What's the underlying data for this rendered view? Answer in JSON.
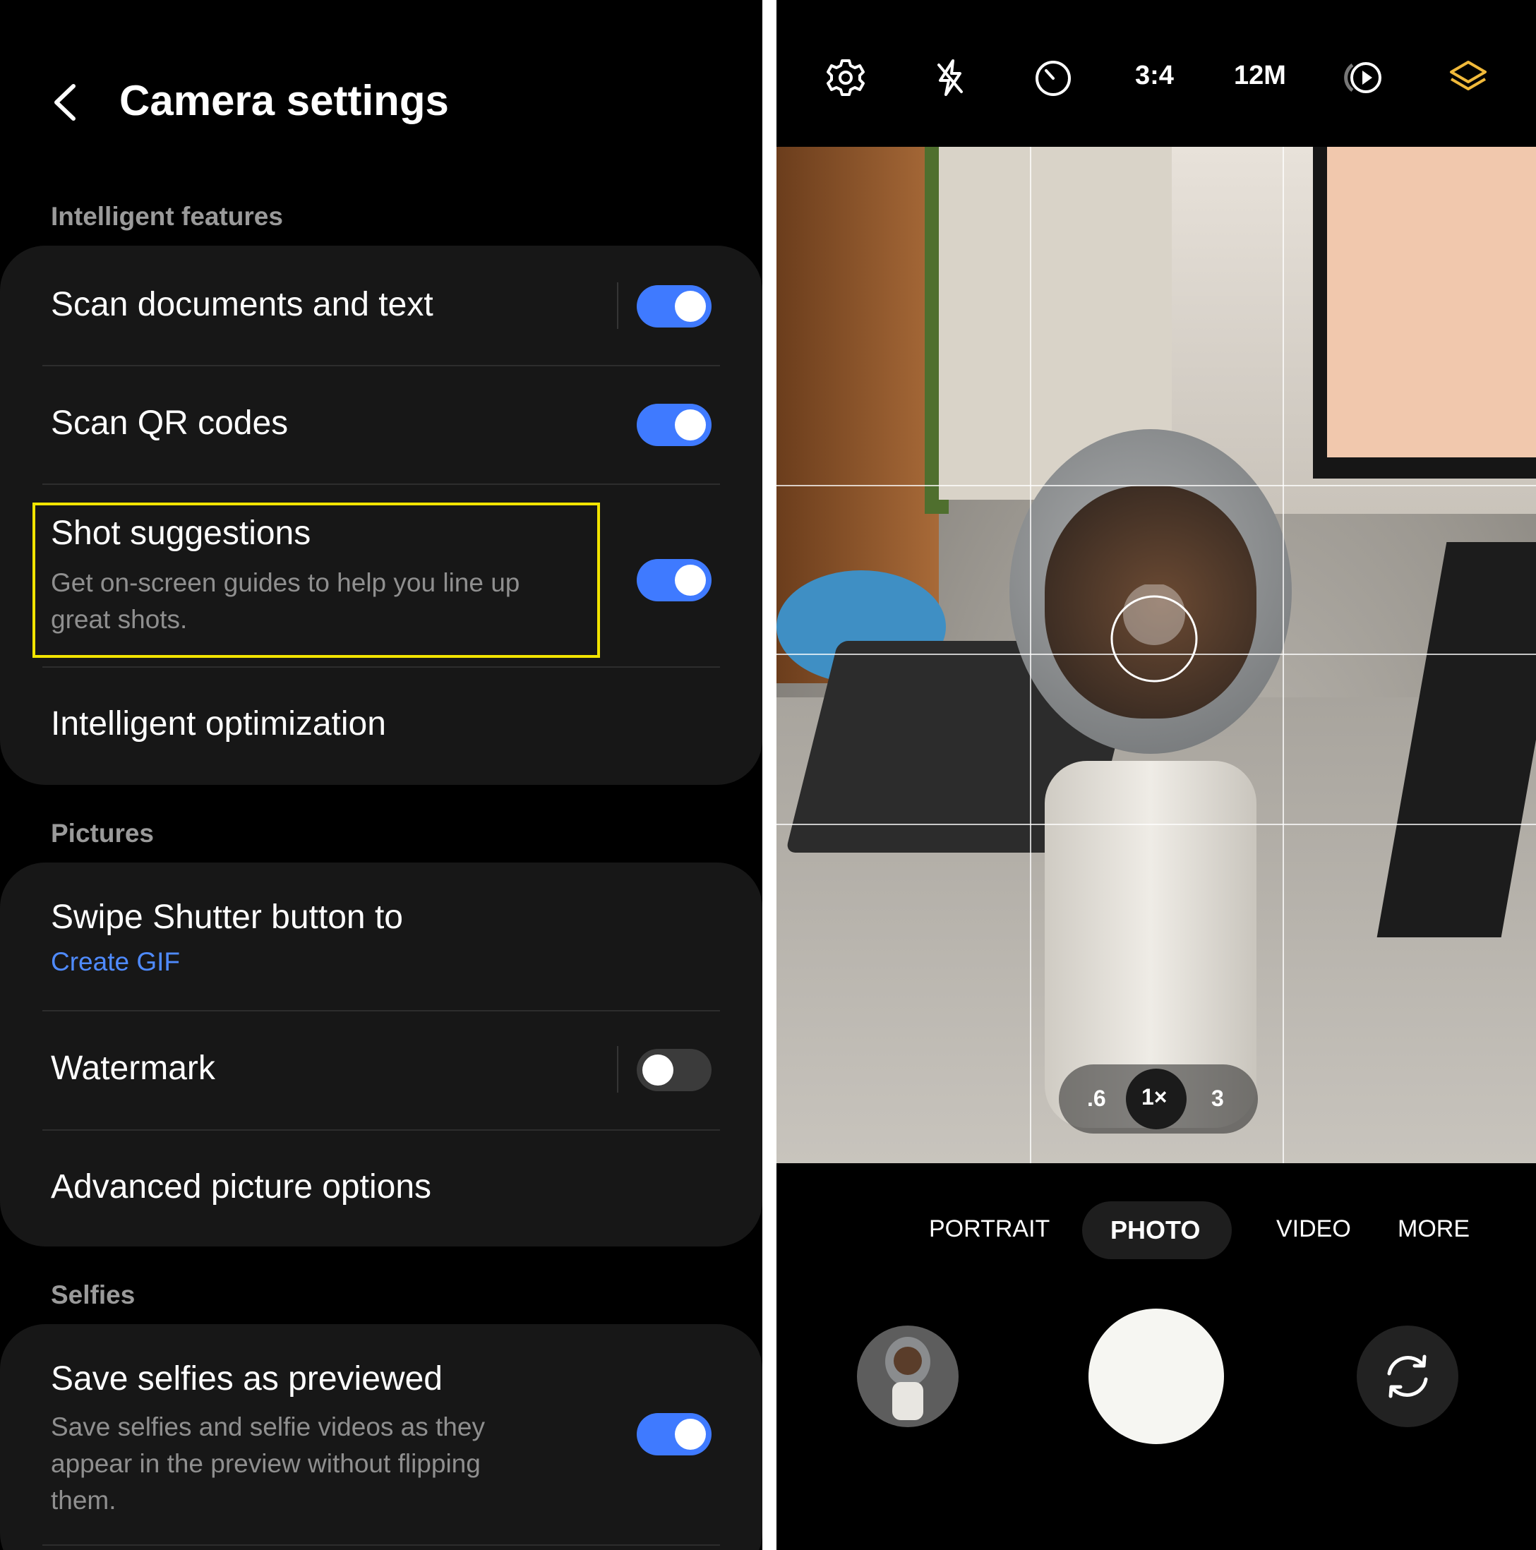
{
  "settings": {
    "title": "Camera settings",
    "sections": {
      "intelligent": {
        "header": "Intelligent features",
        "scan_docs": "Scan documents and text",
        "scan_qr": "Scan QR codes",
        "shot_suggestions": "Shot suggestions",
        "shot_suggestions_desc_1": "Get on-screen guides to help you line up",
        "shot_suggestions_desc_2": "great shots.",
        "intelligent_optimization": "Intelligent optimization"
      },
      "pictures": {
        "header": "Pictures",
        "swipe_shutter": "Swipe Shutter button to",
        "swipe_shutter_value": "Create GIF",
        "watermark": "Watermark",
        "advanced": "Advanced picture options"
      },
      "selfies": {
        "header": "Selfies",
        "save_selfies": "Save selfies as previewed",
        "save_selfies_desc_1": "Save selfies and selfie videos as they",
        "save_selfies_desc_2": "appear in the preview without flipping",
        "save_selfies_desc_3": "them."
      }
    },
    "toggles": {
      "scan_docs": true,
      "scan_qr": true,
      "shot_suggestions": true,
      "watermark": false,
      "save_selfies": true
    },
    "colors": {
      "toggle_on": "#3f7aff",
      "link": "#4f8bff",
      "highlight": "#f2e400"
    }
  },
  "camera": {
    "top_bar": {
      "icons": [
        "settings-gear-icon",
        "flash-off-icon",
        "timer-icon",
        "motion-photo-icon",
        "filters-layers-icon"
      ],
      "aspect_ratio": "3:4",
      "resolution": "12M"
    },
    "zoom": {
      "wide": ".6",
      "main": "1×",
      "tele": "3"
    },
    "modes": {
      "portrait": "PORTRAIT",
      "photo": "PHOTO",
      "video": "VIDEO",
      "more": "MORE"
    },
    "accent_color": "#f0b93a"
  }
}
